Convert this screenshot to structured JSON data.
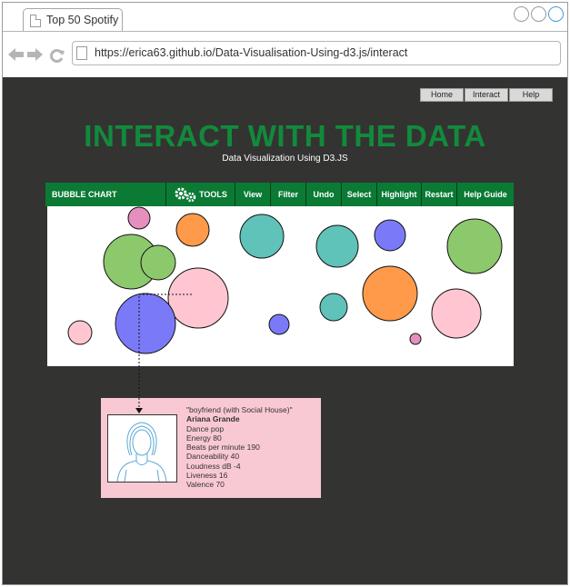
{
  "browser": {
    "tab_title": "Top 50 Spotify",
    "url": "https://erica63.github.io/Data-Visualisation-Using-d3.js/interact"
  },
  "topnav": [
    {
      "label": "Home"
    },
    {
      "label": "Interact"
    },
    {
      "label": "Help"
    }
  ],
  "hero": {
    "title": "INTERACT WITH THE DATA",
    "subtitle": "Data Visualization Using D3.JS"
  },
  "toolbar": {
    "title": "BUBBLE CHART",
    "tools_label": "TOOLS",
    "items": [
      {
        "label": "View"
      },
      {
        "label": "Filter"
      },
      {
        "label": "Undo"
      },
      {
        "label": "Select"
      },
      {
        "label": "Highlight"
      },
      {
        "label": "Restart"
      },
      {
        "label": "Help Guide"
      }
    ]
  },
  "info_card": {
    "lines": [
      {
        "text": "\"boyfriend (with Social House)\"",
        "bold": false
      },
      {
        "text": "Ariana Grande",
        "bold": true
      },
      {
        "text": "Dance pop",
        "bold": false
      },
      {
        "text": "Energy 80",
        "bold": false
      },
      {
        "text": "Beats per minute 190",
        "bold": false
      },
      {
        "text": "Danceability 40",
        "bold": false
      },
      {
        "text": "Loudness dB -4",
        "bold": false
      },
      {
        "text": "Liveness 16",
        "bold": false
      },
      {
        "text": "Valence 70",
        "bold": false
      }
    ]
  },
  "colors": {
    "page_bg": "#333432",
    "accent_green": "#128a3c",
    "toolbar_green": "#0b7a34",
    "card_pink": "#f9c9d3"
  },
  "chart_data": {
    "type": "bubble",
    "bubbles": [
      {
        "color": "#e58fbe"
      },
      {
        "color": "#ff9a4a"
      },
      {
        "color": "#5fc3b9"
      },
      {
        "color": "#8cc96d"
      },
      {
        "color": "#7a7af8"
      },
      {
        "color": "#8cc96d"
      },
      {
        "color": "#5fc3b9"
      },
      {
        "color": "#8cc96d"
      },
      {
        "color": "#ffc6d2"
      },
      {
        "color": "#5fc3b9"
      },
      {
        "color": "#ff9a4a"
      },
      {
        "color": "#ffc6d2"
      },
      {
        "color": "#ffc6d2"
      },
      {
        "color": "#7a7af8"
      },
      {
        "color": "#7a7af8"
      },
      {
        "color": "#e58fbe"
      }
    ]
  }
}
